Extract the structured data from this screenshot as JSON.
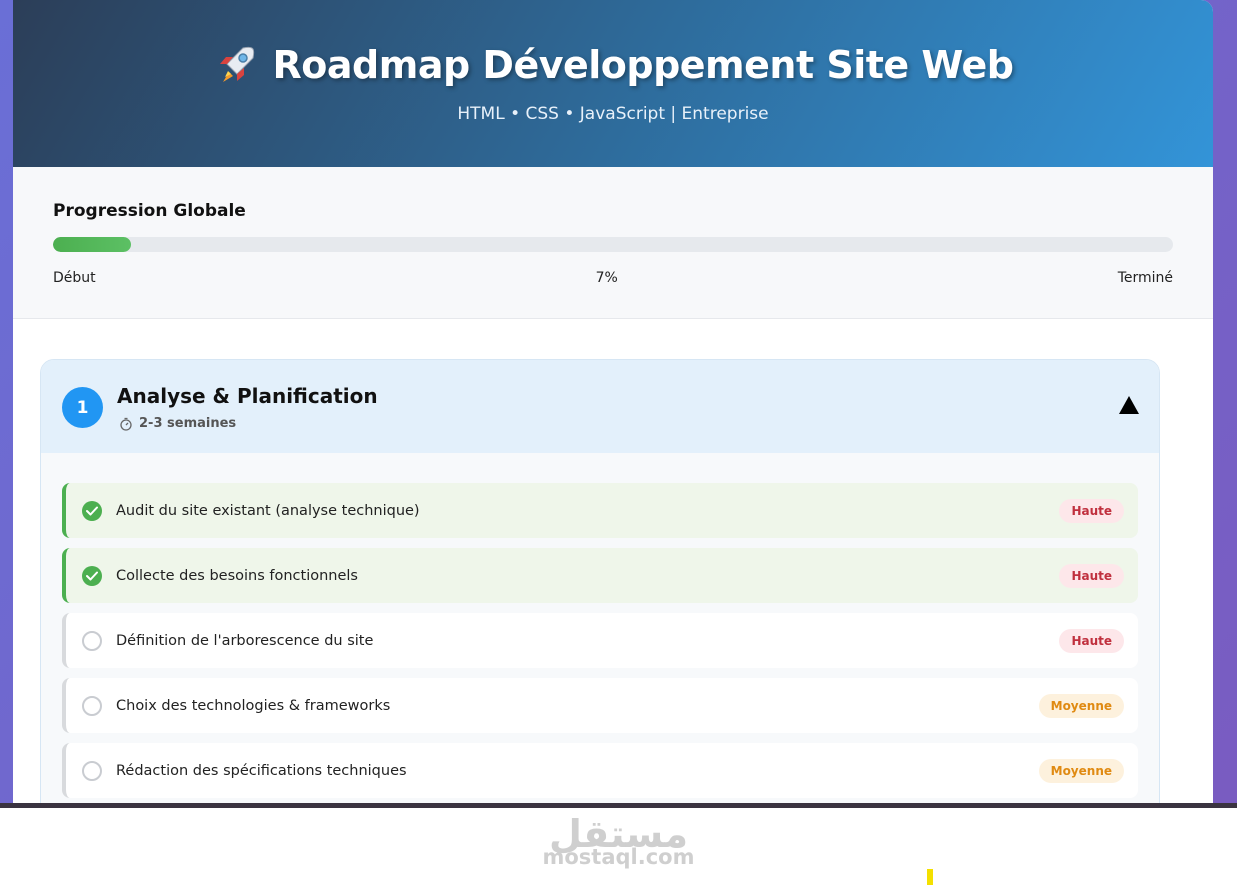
{
  "header": {
    "icon": "rocket-icon",
    "title": "Roadmap Développement Site Web",
    "subtitle": "HTML • CSS • JavaScript | Entreprise"
  },
  "progress": {
    "label": "Progression Globale",
    "percent_value": 7,
    "start_label": "Début",
    "percent_label": "7%",
    "end_label": "Terminé"
  },
  "phase": {
    "number": "1",
    "title": "Analyse & Planification",
    "duration": "2-3 semaines",
    "tasks": [
      {
        "text": "Audit du site existant (analyse technique)",
        "priority": "Haute",
        "done": true
      },
      {
        "text": "Collecte des besoins fonctionnels",
        "priority": "Haute",
        "done": true
      },
      {
        "text": "Définition de l'arborescence du site",
        "priority": "Haute",
        "done": false
      },
      {
        "text": "Choix des technologies & frameworks",
        "priority": "Moyenne",
        "done": false
      },
      {
        "text": "Rédaction des spécifications techniques",
        "priority": "Moyenne",
        "done": false
      }
    ]
  },
  "watermark": {
    "arabic": "مستقل",
    "latin": "mostaql.com"
  },
  "colors": {
    "accent": "#2196f3",
    "done": "#4caf50",
    "high": "#c0303e",
    "medium": "#e08a12"
  }
}
